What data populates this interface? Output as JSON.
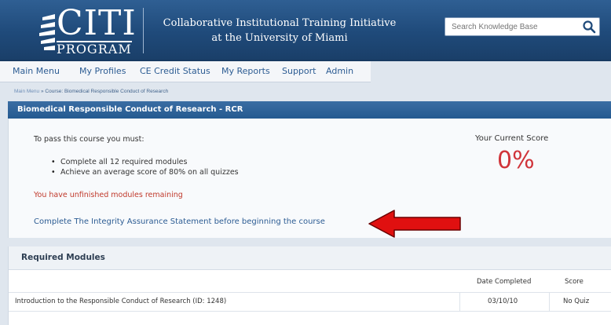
{
  "header": {
    "logo_text": "CITI",
    "logo_subtext": "PROGRAM",
    "title_line1": "Collaborative Institutional Training Initiative",
    "title_line2": "at the University of Miami",
    "search_placeholder": "Search Knowledge Base",
    "search_icon": "search-icon"
  },
  "nav": {
    "items": [
      "Main Menu",
      "My Profiles",
      "CE Credit Status",
      "My Reports",
      "Support",
      "Admin"
    ]
  },
  "breadcrumb": {
    "home": "Main Menu",
    "separator": " » ",
    "current": "Course: Biomedical Responsible Conduct of Research"
  },
  "course": {
    "title": "Biomedical Responsible Conduct of Research - RCR",
    "pass_intro": "To pass this course you must:",
    "requirements": [
      "Complete all 12 required modules",
      "Achieve an average score of 80% on all quizzes"
    ],
    "warning": "You have unfinished modules remaining",
    "integrity_link": "Complete The Integrity Assurance Statement before beginning the course",
    "score_label": "Your Current Score",
    "score_value": "0%"
  },
  "modules": {
    "title": "Required Modules",
    "columns": [
      "Date Completed",
      "Score"
    ],
    "rows": [
      {
        "name": "Introduction to the Responsible Conduct of Research (ID: 1248)",
        "date": "03/10/10",
        "score": "No Quiz"
      }
    ]
  },
  "colors": {
    "header_blue": "#1f4a7a",
    "link_blue": "#2c5c93",
    "warning_red": "#c0392b",
    "score_red": "#d0343a",
    "arrow_red": "#e01010"
  }
}
